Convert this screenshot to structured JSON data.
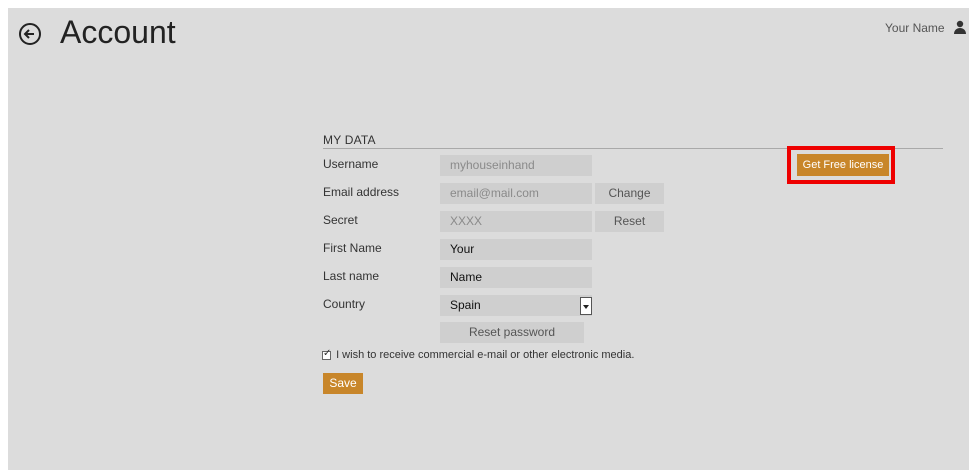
{
  "header": {
    "title": "Account",
    "user_name": "Your Name"
  },
  "section": {
    "title": "MY DATA"
  },
  "form": {
    "username_label": "Username",
    "username_value": "myhouseinhand",
    "email_label": "Email address",
    "email_value": "email@mail.com",
    "change_button": "Change",
    "secret_label": "Secret",
    "secret_value": "XXXX",
    "reset_button": "Reset",
    "first_name_label": "First Name",
    "first_name_value": "Your",
    "last_name_label": "Last name",
    "last_name_value": "Name",
    "country_label": "Country",
    "country_value": "Spain",
    "reset_password_button": "Reset password",
    "newsletter_text": "I wish to receive commercial e-mail or other electronic media.",
    "newsletter_checked": true,
    "save_button": "Save"
  },
  "license": {
    "button_label": "Get Free license"
  },
  "colors": {
    "background": "#dcdcdc",
    "accent": "#c8862a",
    "highlight": "#ee0000"
  }
}
